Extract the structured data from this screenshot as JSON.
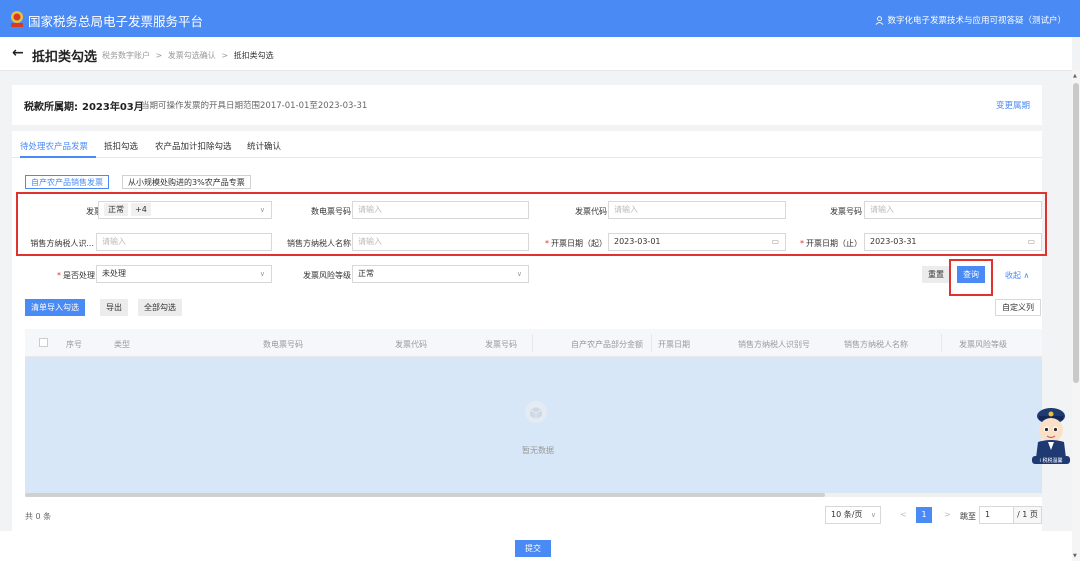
{
  "topbar": {
    "title": "国家税务总局电子发票服务平台",
    "user": "数字化电子发票技术与应用可视答疑（测试户）",
    "color": "#4a8af4"
  },
  "header": {
    "back": "←",
    "title": "抵扣类勾选",
    "breadcrumb": [
      "税务数字账户",
      "发票勾选确认",
      "抵扣类勾选"
    ],
    "sep": ">"
  },
  "period": {
    "label": "税款所属期:",
    "value": "2023年03月",
    "note": "当期可操作发票的开具日期范围2017-01-01至2023-03-31",
    "change": "变更属期"
  },
  "tabs": [
    "待处理农产品发票",
    "抵扣勾选",
    "农产品加计扣除勾选",
    "统计确认"
  ],
  "subtabs": [
    "自产农产品销售发票",
    "从小规模处购进的3%农产品专票"
  ],
  "filters": {
    "status_label": "发票状态",
    "status_tags": [
      "正常",
      "+4"
    ],
    "digital_no_label": "数电票号码",
    "code_label": "发票代码",
    "no_label": "发票号码",
    "seller_id_label": "销售方纳税人识...",
    "seller_name_label": "销售方纳税人名称",
    "start_label": "开票日期（起）",
    "start_value": "2023-03-01",
    "end_label": "开票日期（止）",
    "end_value": "2023-03-31",
    "placeholder": "请输入",
    "processed_label": "是否处理",
    "processed_value": "未处理",
    "risk_label": "发票风险等级",
    "risk_value": "正常"
  },
  "buttons": {
    "reset": "重置",
    "query": "查询",
    "collapse": "收起 ∧",
    "import": "清单导入勾选",
    "export": "导出",
    "select_all": "全部勾选",
    "custom_cols": "自定义列",
    "submit": "提交"
  },
  "table": {
    "columns": [
      "序号",
      "类型",
      "数电票号码",
      "发票代码",
      "发票号码",
      "自产农产品部分金额",
      "开票日期",
      "销售方纳税人识别号",
      "销售方纳税人名称",
      "发票风险等级"
    ],
    "empty": "暂无数据"
  },
  "pagination": {
    "total": "共 0 条",
    "page_size": "10 条/页",
    "current": "1",
    "jump_label": "跳至",
    "jump_value": "1",
    "total_pages": "/ 1 页",
    "prev": "<",
    "next": ">"
  },
  "mascot_badge": "i 税税温馨"
}
